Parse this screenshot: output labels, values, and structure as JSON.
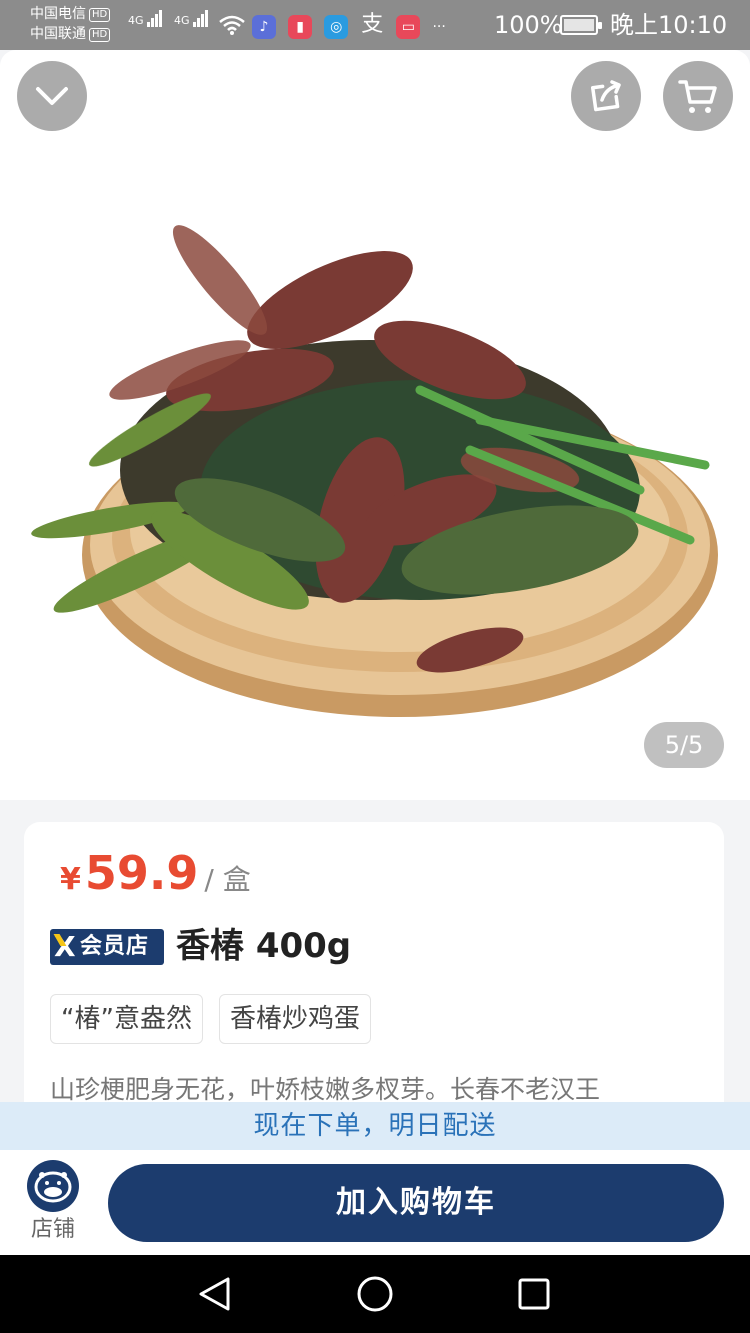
{
  "status_bar": {
    "carrier_1": "中国电信",
    "carrier_2": "中国联通",
    "hd_label": "HD",
    "network": "4G",
    "battery_percent": "100%",
    "time": "晚上10:10",
    "more": "···"
  },
  "hero": {
    "image_counter": "5/5",
    "product_image_alt": "香椿"
  },
  "product": {
    "currency": "¥",
    "price": "59.9",
    "unit": "/ 盒",
    "badge_label": "会员店",
    "badge_letter": "X",
    "title": "香椿 400g",
    "tags": [
      "“椿”意盎然",
      "香椿炒鸡蛋"
    ],
    "description": "山珍梗肥身无花，叶娇枝嫩多杈芽。长春不老汉王"
  },
  "delivery_banner": "现在下单，明日配送",
  "actions": {
    "store_label": "店铺",
    "add_to_cart_label": "加入购物车"
  },
  "colors": {
    "brand_navy": "#1c3c6e",
    "price_red": "#e84b32",
    "banner_bg": "#dcebf8",
    "banner_text": "#2a72b8"
  },
  "icons": {
    "collapse": "chevron-down-icon",
    "share": "share-icon",
    "cart": "shopping-cart-icon",
    "store": "store-mascot-icon",
    "back": "back-triangle-icon",
    "home": "home-circle-icon",
    "recents": "recents-square-icon"
  }
}
